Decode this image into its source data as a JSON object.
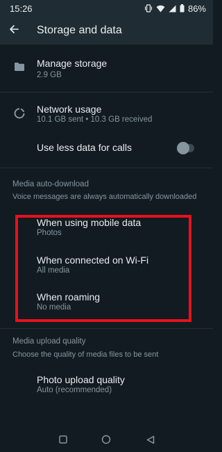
{
  "status_bar": {
    "time": "15:26",
    "battery": "86%",
    "icons": [
      "vibrate-icon",
      "wifi-icon",
      "signal-icon",
      "battery-icon"
    ]
  },
  "app_bar": {
    "title": "Storage and data",
    "back_icon": "arrow-left-icon"
  },
  "storage": {
    "manage": {
      "title": "Manage storage",
      "subtitle": "2.9 GB",
      "icon": "folder-icon"
    },
    "network": {
      "title": "Network usage",
      "subtitle": "10.1 GB sent • 10.3 GB received",
      "icon": "data-usage-icon"
    },
    "less_data": {
      "title": "Use less data for calls",
      "enabled": false
    }
  },
  "auto_download": {
    "header": "Media auto-download",
    "description": "Voice messages are always automatically downloaded",
    "items": [
      {
        "title": "When using mobile data",
        "subtitle": "Photos"
      },
      {
        "title": "When connected on Wi-Fi",
        "subtitle": "All media"
      },
      {
        "title": "When roaming",
        "subtitle": "No media"
      }
    ]
  },
  "upload_quality": {
    "header": "Media upload quality",
    "description": "Choose the quality of media files to be sent",
    "photo": {
      "title": "Photo upload quality",
      "subtitle": "Auto (recommended)"
    }
  },
  "nav_bar": {
    "buttons": [
      "recents-square-icon",
      "home-circle-icon",
      "back-triangle-icon"
    ]
  },
  "colors": {
    "background": "#121b22",
    "bar": "#1f2c34",
    "text_primary": "#e9edef",
    "text_secondary": "#8696a0",
    "highlight": "#e8111b"
  }
}
